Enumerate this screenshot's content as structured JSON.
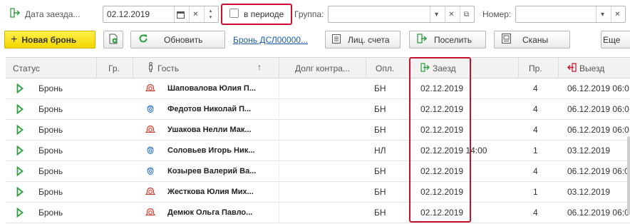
{
  "filters": {
    "arrival_date_label": "Дата заезда...",
    "arrival_date_value": "02.12.2019",
    "in_period_label": "в периоде",
    "in_period_checked": false,
    "group_label": "Группа:",
    "group_value": "",
    "room_label": "Номер:",
    "room_value": ""
  },
  "toolbar": {
    "new_booking_label": "Новая бронь",
    "refresh_label": "Обновить",
    "booking_link": "Бронь ДСЛ00000...",
    "accounts_label": "Лиц. счета",
    "check_in_label": "Поселить",
    "scans_label": "Сканы",
    "more_label": "Еще"
  },
  "table": {
    "columns": [
      "Статус",
      "Гр.",
      "Гость",
      "Долг контра...",
      "Опл.",
      "Заезд",
      "Пр.",
      "Выезд"
    ],
    "rows": [
      {
        "status": "Бронь",
        "gender": "female",
        "guest": "Шаповалова Юлия П...",
        "debt": "",
        "paid": "БН",
        "arrival": "02.12.2019",
        "days": "4",
        "departure": "06.12.2019 06:0"
      },
      {
        "status": "Бронь",
        "gender": "male",
        "guest": "Федотов Николай П...",
        "debt": "",
        "paid": "БН",
        "arrival": "02.12.2019",
        "days": "4",
        "departure": "06.12.2019 06:0"
      },
      {
        "status": "Бронь",
        "gender": "female",
        "guest": "Ушакова Нелли Мак...",
        "debt": "",
        "paid": "БН",
        "arrival": "02.12.2019",
        "days": "4",
        "departure": "06.12.2019 06:0"
      },
      {
        "status": "Бронь",
        "gender": "male",
        "guest": "Соловьев Игорь Ник...",
        "debt": "",
        "paid": "НЛ",
        "arrival": "02.12.2019 14:00",
        "days": "1",
        "departure": "03.12.2019"
      },
      {
        "status": "Бронь",
        "gender": "male",
        "guest": "Козырев Валерий Ва...",
        "debt": "",
        "paid": "БН",
        "arrival": "02.12.2019",
        "days": "4",
        "departure": "06.12.2019 06:0"
      },
      {
        "status": "Бронь",
        "gender": "female",
        "guest": "Жесткова Юлия Мих...",
        "debt": "",
        "paid": "БН",
        "arrival": "02.12.2019",
        "days": "1",
        "departure": "03.12.2019"
      },
      {
        "status": "Бронь",
        "gender": "female",
        "guest": "Демюк Ольга Павло...",
        "debt": "",
        "paid": "БН",
        "arrival": "02.12.2019",
        "days": "4",
        "departure": "06.12.2019 06:0"
      }
    ]
  },
  "colors": {
    "highlight": "#c8102e",
    "primary_button": "#f2d600",
    "link": "#1a5ca8",
    "status_green": "#2e9e3e",
    "female_icon": "#c0392b",
    "male_icon": "#3a7bbf"
  }
}
